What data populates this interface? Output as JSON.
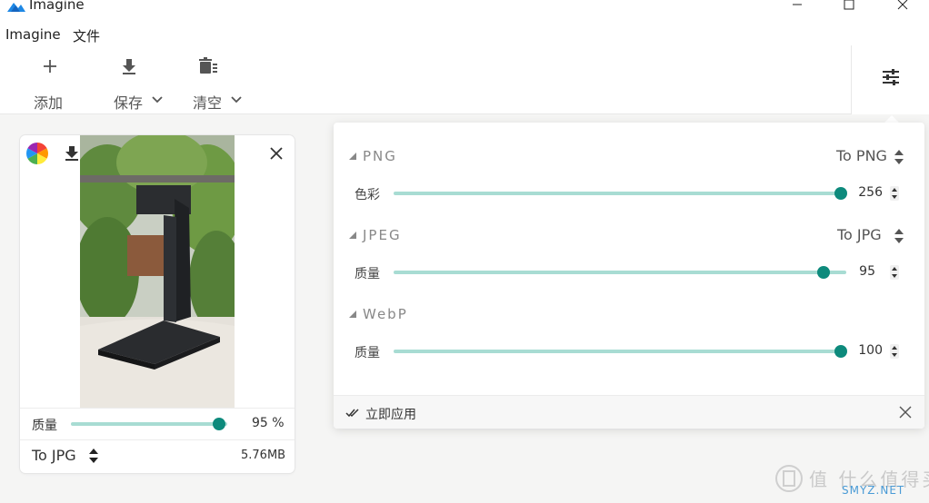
{
  "app": {
    "title": "Imagine"
  },
  "menu": {
    "items": [
      "Imagine",
      "文件"
    ]
  },
  "toolbar": {
    "add_label": "添加",
    "save_label": "保存",
    "clear_label": "清空"
  },
  "card": {
    "quality_label": "质量",
    "quality_value": "95 %",
    "quality_fraction": 0.95,
    "format": "To JPG",
    "file_size": "5.76MB"
  },
  "panel": {
    "png": {
      "title": "PNG",
      "format": "To PNG",
      "label": "色彩",
      "value": "256",
      "fraction": 1.0
    },
    "jpeg": {
      "title": "JPEG",
      "format": "To JPG",
      "label": "质量",
      "value": "95",
      "fraction": 0.95
    },
    "webp": {
      "title": "WebP",
      "label": "质量",
      "value": "100",
      "fraction": 1.0
    },
    "apply_label": "立即应用"
  },
  "watermark": {
    "text": "值 什么值得买",
    "sub": "SMYZ.NET"
  },
  "colors": {
    "accent": "#0d8a7c",
    "track": "#a8dcd3"
  }
}
